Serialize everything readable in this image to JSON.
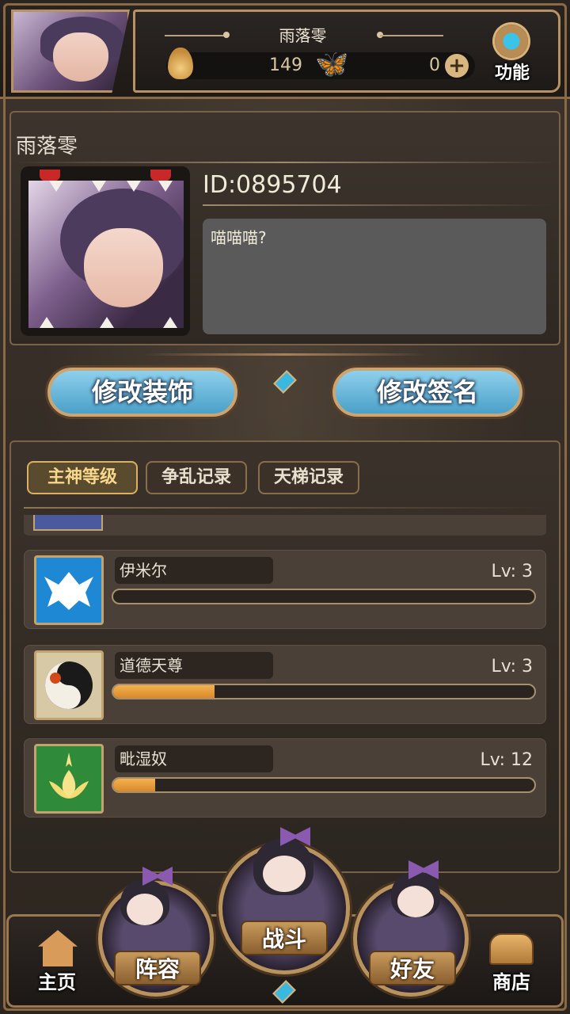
{
  "topbar": {
    "player_name": "雨落零",
    "currency_a": "149",
    "currency_b": "0",
    "function_label": "功能",
    "icons": {
      "currency_a_icon": "flame-spirit-icon",
      "currency_b_icon": "butterfly-icon",
      "add_icon": "plus-icon",
      "function_icon": "gear-icon"
    }
  },
  "profile": {
    "name": "雨落零",
    "id": "ID:0895704",
    "signature": "喵喵喵?"
  },
  "actions": {
    "edit_decoration": "修改装饰",
    "edit_signature": "修改签名"
  },
  "records": {
    "tabs": [
      {
        "label": "主神等级",
        "active": true
      },
      {
        "label": "争乱记录",
        "active": false
      },
      {
        "label": "天梯记录",
        "active": false
      }
    ],
    "gods": [
      {
        "name": "伊米尔",
        "level": "Lv: 3",
        "progress": 0.0,
        "icon": "frost-giant-icon",
        "color": "#1e88d4"
      },
      {
        "name": "道德天尊",
        "level": "Lv: 3",
        "progress": 0.24,
        "icon": "yin-yang-icon",
        "color": "#d8c9a6"
      },
      {
        "name": "毗湿奴",
        "level": "Lv: 12",
        "progress": 0.1,
        "icon": "lotus-icon",
        "color": "#2f8a3a"
      }
    ]
  },
  "bottom_nav": {
    "home": "主页",
    "lineup": "阵容",
    "battle": "战斗",
    "friends": "好友",
    "shop": "商店"
  },
  "colors": {
    "accent_gold": "#b89264",
    "button_blue": "#6ab8dc",
    "xp_orange": "#f0a848",
    "active_tab": "#f7d78a"
  }
}
